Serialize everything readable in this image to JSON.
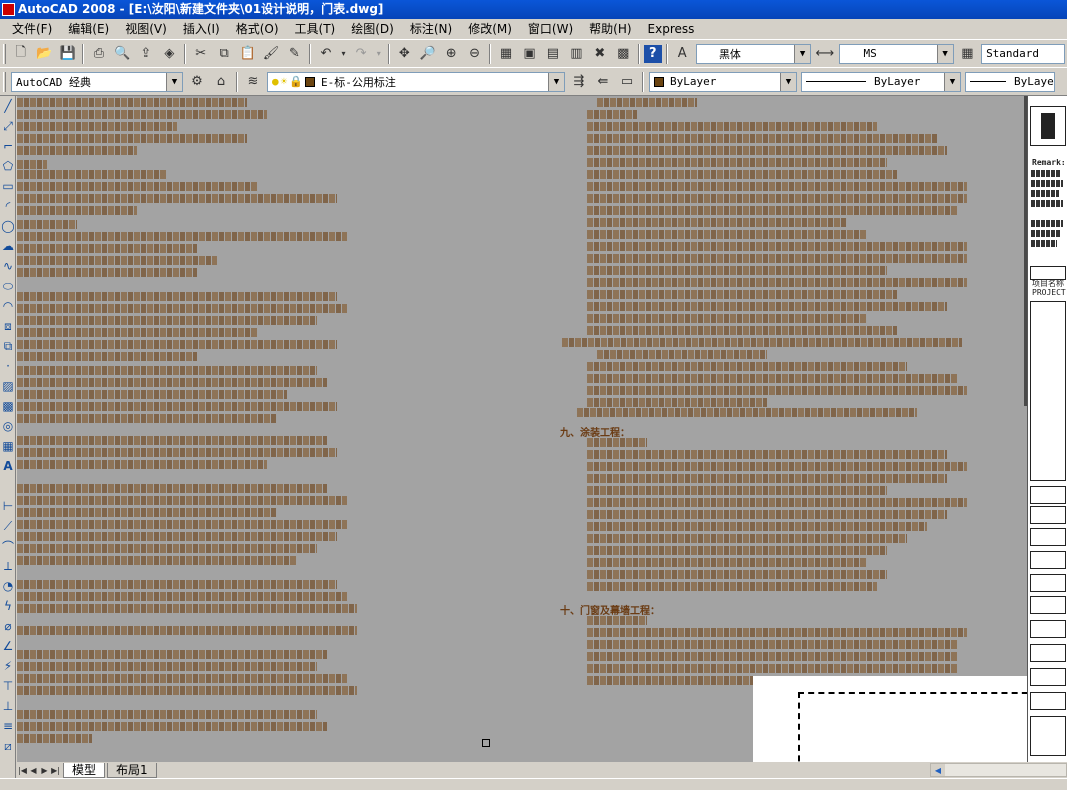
{
  "title": "AutoCAD 2008 - [E:\\汝阳\\新建文件夹\\01设计说明，门表.dwg]",
  "menu": [
    "文件(F)",
    "编辑(E)",
    "视图(V)",
    "插入(I)",
    "格式(O)",
    "工具(T)",
    "绘图(D)",
    "标注(N)",
    "修改(M)",
    "窗口(W)",
    "帮助(H)",
    "Express"
  ],
  "toolbar1": {
    "text_style": "黑体",
    "dim_style": "MS",
    "table_style": "Standard"
  },
  "toolbar2": {
    "workspace": "AutoCAD 经典",
    "layer": "E-标-公用标注",
    "color": "ByLayer",
    "linetype": "ByLayer",
    "lineweight": "ByLayer"
  },
  "tabs": [
    "模型",
    "布局1"
  ],
  "colors": {
    "canvas": "#a3a3a3",
    "text": "#6b3c14",
    "titlebar": "#0a56d8"
  },
  "drawing_headings": {
    "section_9": "九、涂装工程：",
    "section_10": "十、门窗及幕墙工程："
  },
  "right_panel": {
    "remark": "Remark:",
    "project": "项目名称",
    "proj_code": "PROJECT"
  }
}
